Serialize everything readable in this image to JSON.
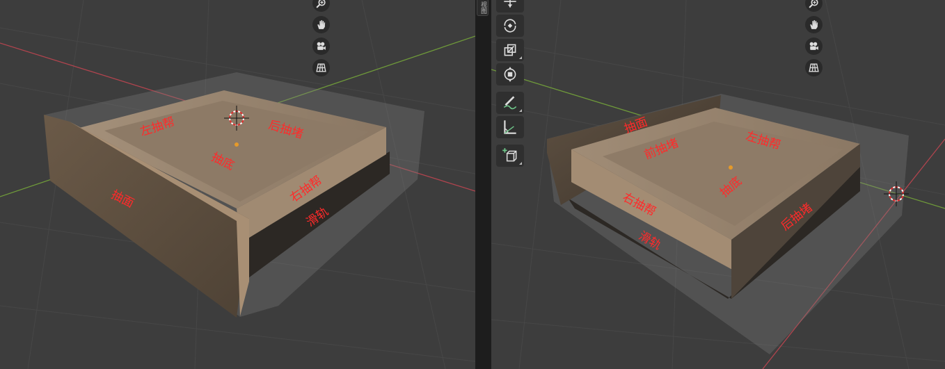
{
  "sidebar_tab": {
    "label": "视图"
  },
  "left_viewport": {
    "labels": {
      "left_side": "左抽帮",
      "back_panel": "后抽堵",
      "bottom": "抽底",
      "right_side": "右抽帮",
      "front": "抽面",
      "slide": "滑轨"
    },
    "nav_icons": [
      "zoom-icon",
      "hand-pan-icon",
      "camera-icon",
      "grid-perspective-icon"
    ]
  },
  "right_viewport": {
    "labels": {
      "front": "抽面",
      "front_panel": "前抽堵",
      "left_side": "左抽帮",
      "bottom": "抽底",
      "right_side": "右抽帮",
      "back_panel": "后抽堵",
      "slide": "滑轨"
    },
    "nav_icons": [
      "zoom-icon",
      "hand-pan-icon",
      "camera-icon",
      "grid-perspective-icon"
    ]
  },
  "toolbar": {
    "tools": [
      "move-icon",
      "rotate-icon",
      "scale-icon",
      "transform-icon",
      "annotate-icon",
      "measure-icon",
      "add-cube-icon"
    ]
  },
  "colors": {
    "viewport_bg": "#3d3d3d",
    "label": "#ff2a2a",
    "x_axis": "#b0444e",
    "y_axis": "#6f9a3a",
    "wood_light": "#9a8670",
    "wood_dark": "#5f5142"
  }
}
